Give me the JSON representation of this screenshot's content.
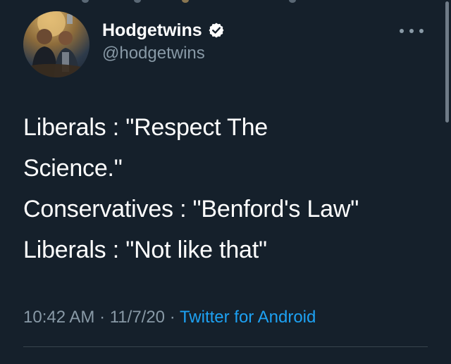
{
  "tweet": {
    "author": {
      "display_name": "Hodgetwins",
      "handle": "@hodgetwins",
      "verified": true
    },
    "lines": [
      "Liberals : \"Respect The",
      "Science.\"",
      "Conservatives : \"Benford's Law\"",
      "Liberals : \"Not like that\""
    ],
    "meta": {
      "time": "10:42 AM",
      "date": "11/7/20",
      "source": "Twitter for Android",
      "separator": " · "
    }
  },
  "icons": {
    "verified": "verified-badge-icon",
    "more": "more-options-icon"
  },
  "colors": {
    "background": "#15202b",
    "primary_text": "#ffffff",
    "secondary_text": "#8899a6",
    "accent": "#1da1f2"
  }
}
